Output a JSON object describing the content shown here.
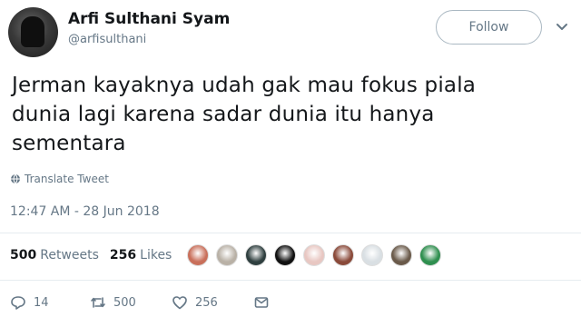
{
  "user": {
    "name": "Arfi Sulthani Syam",
    "handle": "@arfisulthani"
  },
  "follow_label": "Follow",
  "tweet": {
    "lines": [
      "Jerman kayaknya udah gak mau fokus piala",
      "dunia lagi karena sadar dunia itu hanya",
      "sementara"
    ],
    "translate_label": "Translate Tweet",
    "timestamp": "12:47 AM - 28 Jun 2018"
  },
  "stats": {
    "retweets_count": "500",
    "retweets_label": "Retweets",
    "likes_count": "256",
    "likes_label": "Likes"
  },
  "liker_avatars": [
    "#c96f5a",
    "#b9b1a6",
    "#2f3f3f",
    "#111111",
    "#e8c7c2",
    "#8a4a3a",
    "#d9dfe3",
    "#6a5a4a",
    "#2f8f4f"
  ],
  "actions": {
    "reply_count": "14",
    "retweet_count": "500",
    "like_count": "256"
  },
  "icons": {
    "chevron": "chevron-down-icon",
    "globe": "globe-icon",
    "reply": "reply-icon",
    "retweet": "retweet-icon",
    "like": "heart-icon",
    "message": "envelope-icon"
  }
}
